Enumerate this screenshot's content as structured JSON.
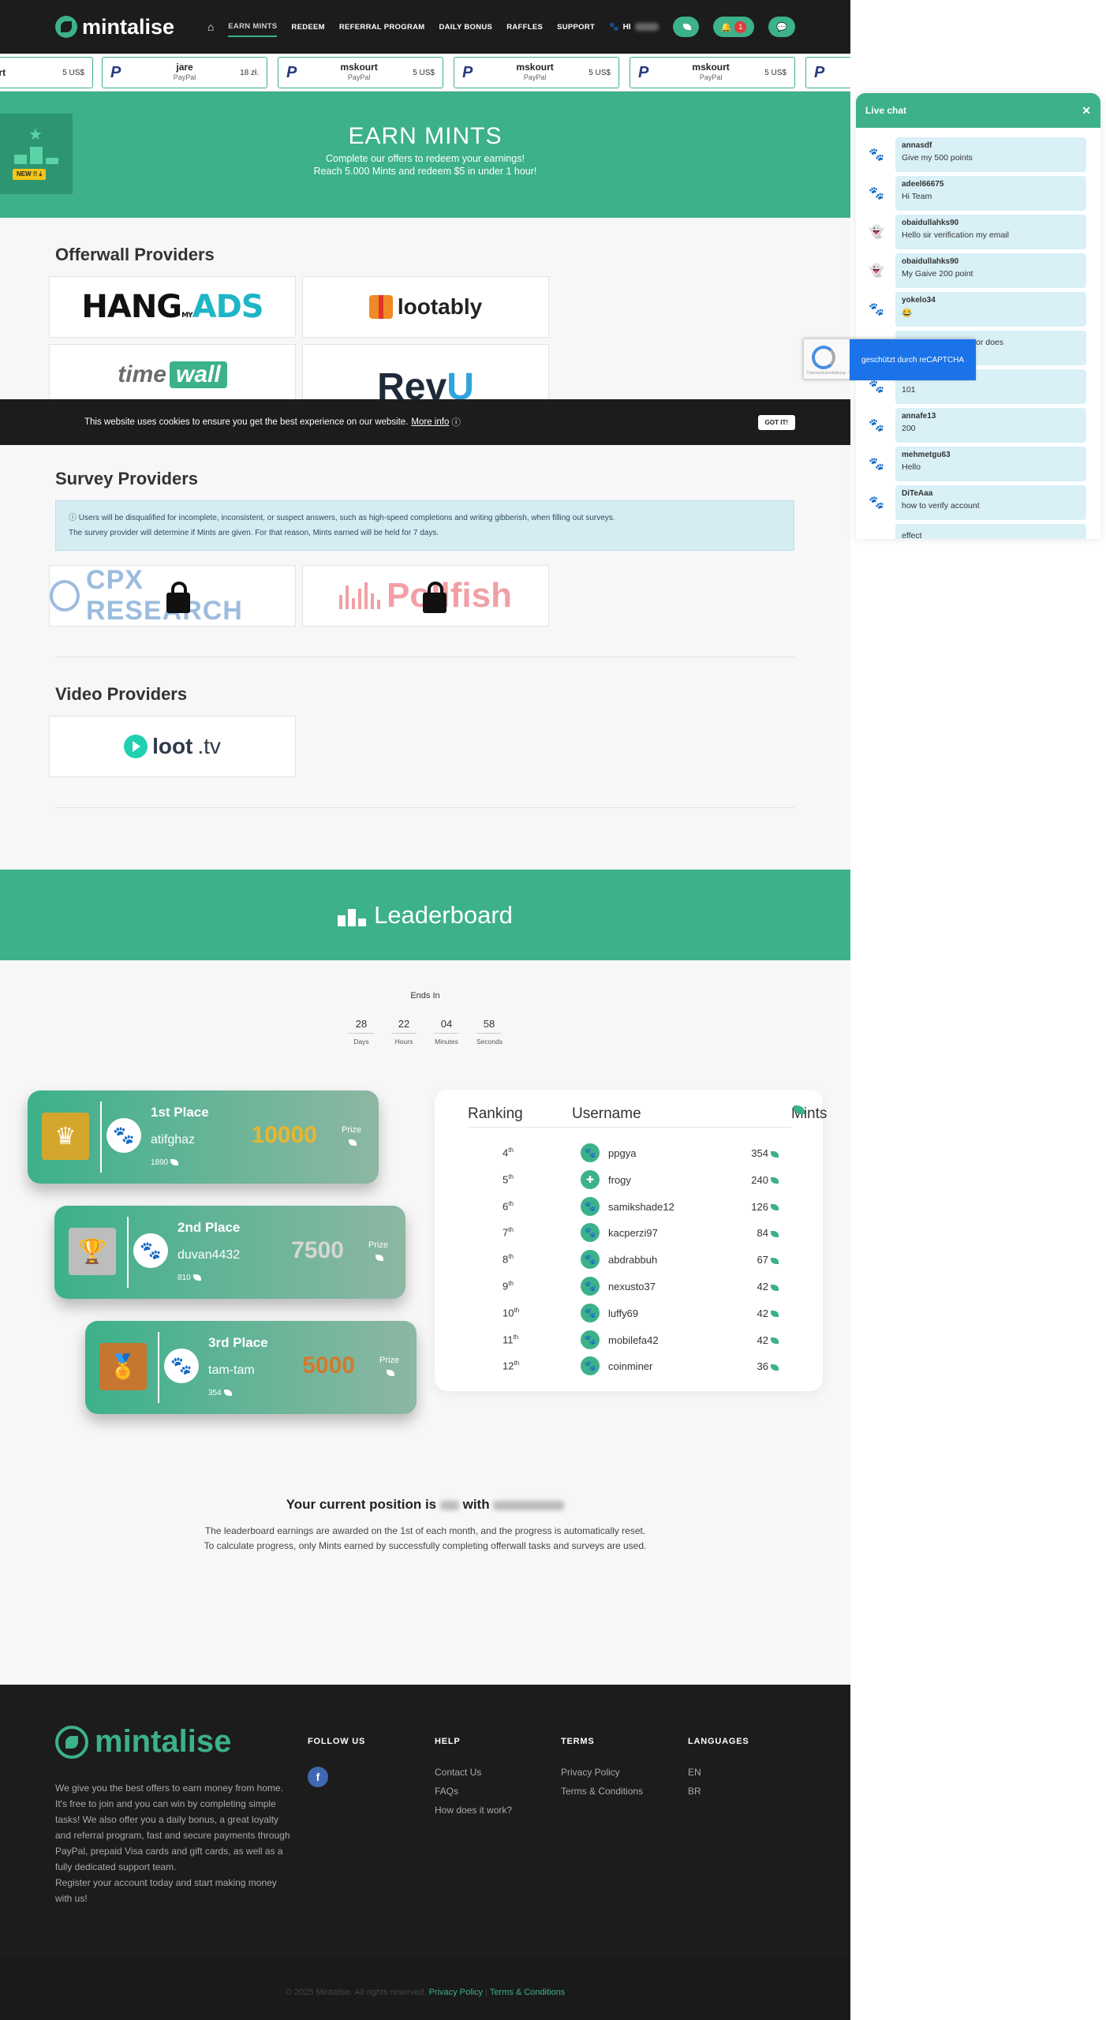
{
  "nav": {
    "brand": "mintalise",
    "links": [
      "EARN MINTS",
      "REDEEM",
      "REFERRAL PROGRAM",
      "DAILY BONUS",
      "RAFFLES",
      "SUPPORT"
    ],
    "greeting": "HI",
    "notification_count": "1"
  },
  "ticker": [
    {
      "user": "urt",
      "method": "",
      "amount": "5 US$"
    },
    {
      "user": "jare",
      "method": "PayPal",
      "amount": "18 zł."
    },
    {
      "user": "mskourt",
      "method": "PayPal",
      "amount": "5 US$"
    },
    {
      "user": "mskourt",
      "method": "PayPal",
      "amount": "5 US$"
    },
    {
      "user": "mskourt",
      "method": "PayPal",
      "amount": "5 US$"
    }
  ],
  "hero": {
    "title": "EARN MINTS",
    "line1": "Complete our offers to redeem your earnings!",
    "line2": "Reach 5.000 Mints and redeem $5 in under 1 hour!",
    "new_tag": "NEW !! ⤓"
  },
  "offerwall": {
    "title": "Offerwall Providers",
    "providers": [
      {
        "name_h": "HANG",
        "name_my": "MY",
        "name_ads": "ADS"
      },
      {
        "name": "lootably"
      },
      {
        "name_a": "time",
        "name_b": "wall"
      },
      {
        "name_a": "Rev",
        "name_b": "U"
      }
    ]
  },
  "cookie": {
    "text": "This website uses cookies to ensure you get the best experience on our website.",
    "more": "More info",
    "button": "GOT IT!"
  },
  "survey": {
    "title": "Survey Providers",
    "notice1": "Users will be disqualified for incomplete, inconsistent, or suspect answers, such as high-speed completions and writing gibberish, when filling out surveys.",
    "notice2": "The survey provider will determine if Mints are given. For that reason, Mints earned will be held for 7 days.",
    "providers": [
      "CPX RESEARCH",
      "Pollfish"
    ]
  },
  "video": {
    "title": "Video Providers",
    "provider_a": "loot",
    "provider_b": ".tv"
  },
  "leaderboard": {
    "title": "Leaderboard",
    "ends_in": "Ends In",
    "timer": [
      {
        "value": "28",
        "label": "Days"
      },
      {
        "value": "22",
        "label": "Hours"
      },
      {
        "value": "04",
        "label": "Minutes"
      },
      {
        "value": "58",
        "label": "Seconds"
      }
    ],
    "podium": [
      {
        "place": "1st Place",
        "user": "atifghaz",
        "mints": "1890",
        "prize": "10000",
        "prize_label": "Prize"
      },
      {
        "place": "2nd Place",
        "user": "duvan4432",
        "mints": "810",
        "prize": "7500",
        "prize_label": "Prize"
      },
      {
        "place": "3rd Place",
        "user": "tam-tam",
        "mints": "354",
        "prize": "5000",
        "prize_label": "Prize"
      }
    ],
    "columns": [
      "Ranking",
      "Username",
      "Mints"
    ],
    "rows": [
      {
        "rank": "4",
        "suffix": "th",
        "user": "ppgya",
        "mints": "354"
      },
      {
        "rank": "5",
        "suffix": "th",
        "user": "frogy",
        "mints": "240"
      },
      {
        "rank": "6",
        "suffix": "th",
        "user": "samikshade12",
        "mints": "126"
      },
      {
        "rank": "7",
        "suffix": "th",
        "user": "kacperzi97",
        "mints": "84"
      },
      {
        "rank": "8",
        "suffix": "th",
        "user": "abdrabbuh",
        "mints": "67"
      },
      {
        "rank": "9",
        "suffix": "th",
        "user": "nexusto37",
        "mints": "42"
      },
      {
        "rank": "10",
        "suffix": "th",
        "user": "luffy69",
        "mints": "42"
      },
      {
        "rank": "11",
        "suffix": "th",
        "user": "mobilefa42",
        "mints": "42"
      },
      {
        "rank": "12",
        "suffix": "th",
        "user": "coinminer",
        "mints": "36"
      }
    ],
    "position_a": "Your current position is",
    "position_b": "with",
    "desc1": "The leaderboard earnings are awarded on the 1st of each month, and the progress is automatically reset.",
    "desc2": "To calculate progress, only Mints earned by successfully completing offerwall tasks and surveys are used."
  },
  "footer": {
    "brand": "mintalise",
    "about": "We give you the best offers to earn money from home. It's free to join and you can win by completing simple tasks! We also offer you a daily bonus, a great loyalty and referral program, fast and secure payments through PayPal, prepaid Visa cards and gift cards, as well as a fully dedicated support team.",
    "about2": "Register your account today and start making money with us!",
    "follow_title": "FOLLOW US",
    "help_title": "HELP",
    "help_links": [
      "Contact Us",
      "FAQs",
      "How does it work?"
    ],
    "terms_title": "TERMS",
    "terms_links": [
      "Privacy Policy",
      "Terms & Conditions"
    ],
    "lang_title": "LANGUAGES",
    "langs": [
      "EN",
      "BR"
    ],
    "copyright": "© 2025 Mintalise. All rights reserved.",
    "privacy": "Privacy Policy",
    "terms": "Terms & Conditions"
  },
  "chat": {
    "title": "Live chat",
    "messages": [
      {
        "user": "annasdf",
        "text": "Give my 500 points"
      },
      {
        "user": "adeel66675",
        "text": "Hi Team"
      },
      {
        "user": "obaidullahks90",
        "text": "Hello sir verification my email"
      },
      {
        "user": "obaidullahks90",
        "text": "My Gaive 200 point"
      },
      {
        "user": "yokelo34",
        "text": "😂"
      },
      {
        "user": "",
        "text": "points 101points..... or does"
      },
      {
        "user": "annafe13",
        "text": "101"
      },
      {
        "user": "annafe13",
        "text": "200"
      },
      {
        "user": "mehmetgu63",
        "text": "Hello"
      },
      {
        "user": "DiTeAaa",
        "text": "how to verify account"
      }
    ],
    "partial_tail": "effect"
  },
  "captcha": {
    "text": "geschützt durch reCAPTCHA",
    "small": "Datenschutzerklärung · Nutzungsbedingungen"
  },
  "colors": {
    "accent": "#3cb18a",
    "dark": "#1c1c1c",
    "gold": "#d4a72c",
    "silver": "#bdbdbd",
    "bronze": "#c5762f"
  }
}
